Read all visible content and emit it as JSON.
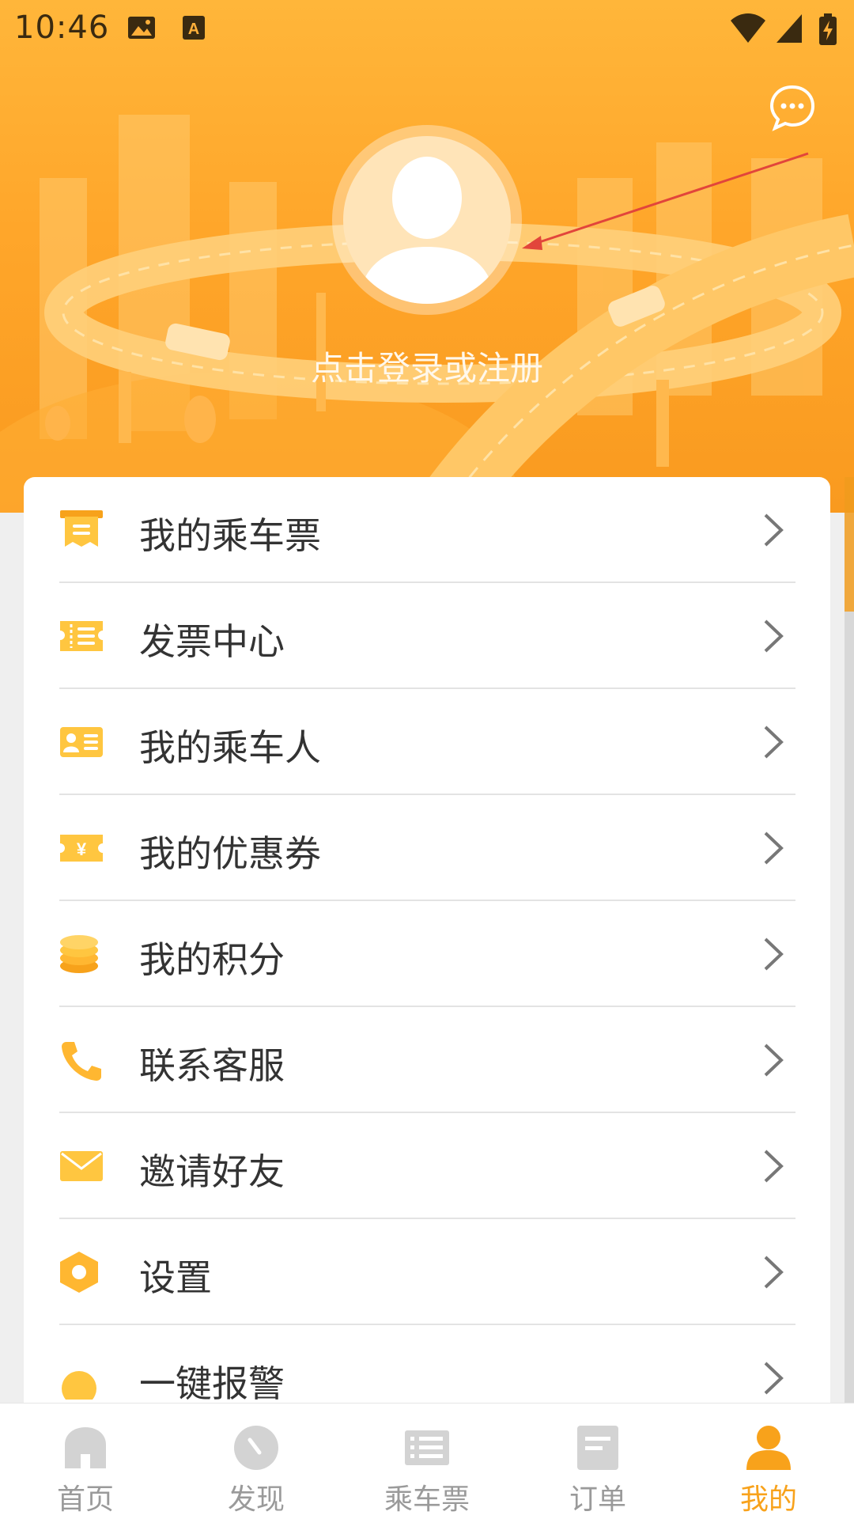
{
  "status_bar": {
    "time": "10:46"
  },
  "header": {
    "login_prompt": "点击登录或注册"
  },
  "menu": [
    {
      "icon": "ticket-icon",
      "label": "我的乘车票"
    },
    {
      "icon": "invoice-icon",
      "label": "发票中心"
    },
    {
      "icon": "passenger-card-icon",
      "label": "我的乘车人"
    },
    {
      "icon": "coupon-icon",
      "label": "我的优惠券"
    },
    {
      "icon": "coins-icon",
      "label": "我的积分"
    },
    {
      "icon": "phone-icon",
      "label": "联系客服"
    },
    {
      "icon": "envelope-icon",
      "label": "邀请好友"
    },
    {
      "icon": "settings-hexagon-icon",
      "label": "设置"
    },
    {
      "icon": "alarm-icon",
      "label": "一键报警"
    }
  ],
  "bottom_nav": [
    {
      "icon": "home-icon",
      "label": "首页",
      "active": false
    },
    {
      "icon": "discover-icon",
      "label": "发现",
      "active": false
    },
    {
      "icon": "ticket-book-icon",
      "label": "乘车票",
      "active": false
    },
    {
      "icon": "order-icon",
      "label": "订单",
      "active": false
    },
    {
      "icon": "profile-icon",
      "label": "我的",
      "active": true
    }
  ],
  "colors": {
    "accent": "#f8a21b",
    "header_top": "#ffb63a",
    "header_bottom": "#f99a1f"
  }
}
